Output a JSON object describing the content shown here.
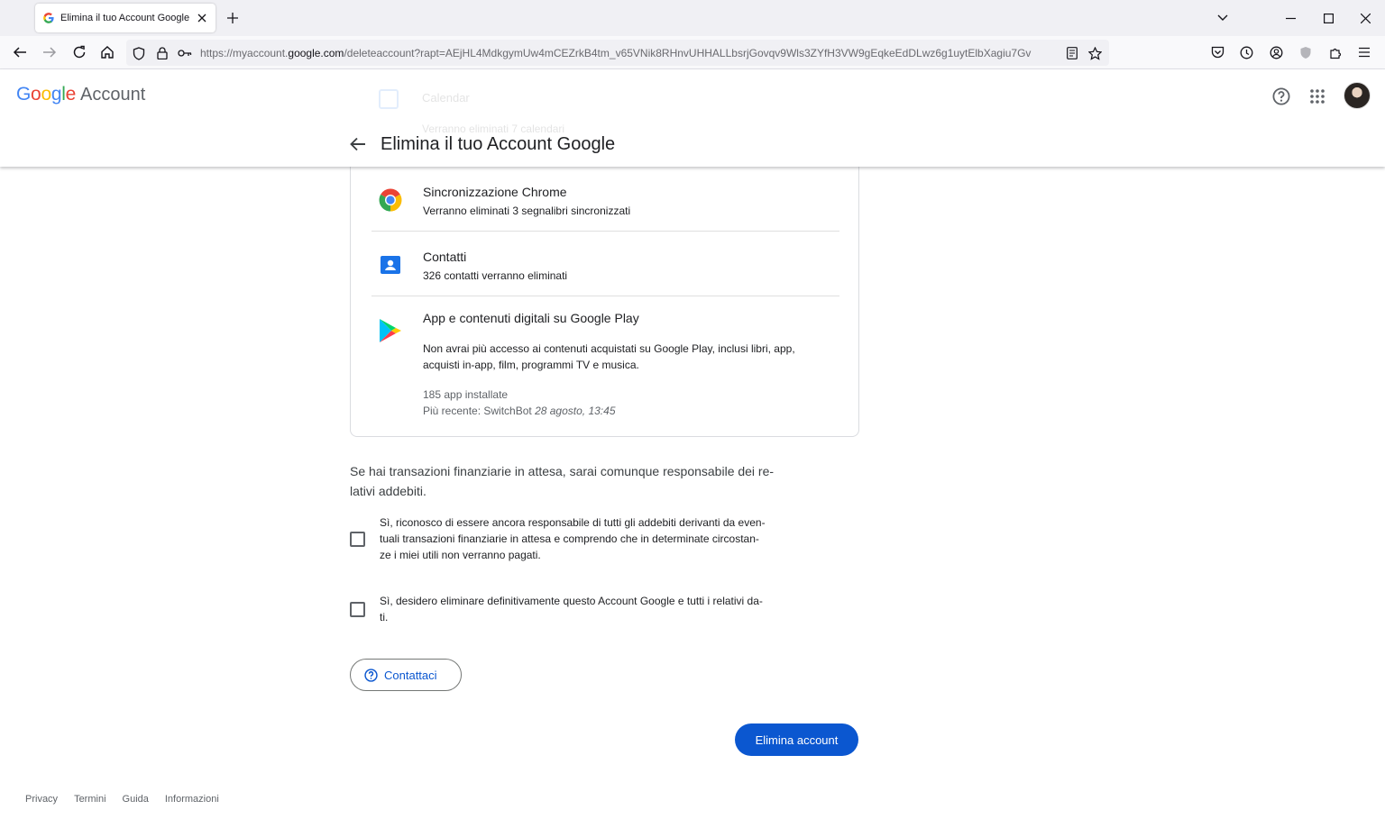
{
  "browser": {
    "tab_title": "Elimina il tuo Account Google",
    "url_prefix": "https://myaccount.",
    "url_domain": "google.com",
    "url_path": "/deleteaccount?rapt=AEjHL4MdkgymUw4mCEZrkB4tm_v65VNik8RHnvUHHALLbsrjGovqv9Wls3ZYfH3VW9gEqkeEdDLwz6g1uytElbXagiu7Gv"
  },
  "header": {
    "logo_letters": [
      "G",
      "o",
      "o",
      "g",
      "l",
      "e"
    ],
    "logo_colors": [
      "#4285f4",
      "#ea4335",
      "#fbbc05",
      "#4285f4",
      "#34a853",
      "#ea4335"
    ],
    "logo_suffix": "Account",
    "page_title": "Elimina il tuo Account Google",
    "faded_item_title": "Calendar",
    "faded_item_subtitle": "Verranno eliminati 7 calendari"
  },
  "services": [
    {
      "icon": "chrome-icon",
      "title": "Sincronizzazione Chrome",
      "subtitle": "Verranno eliminati 3 segnalibri sincronizzati"
    },
    {
      "icon": "contacts-icon",
      "title": "Contatti",
      "subtitle": "326 contatti verranno eliminati"
    },
    {
      "icon": "google-play-icon",
      "title": "App e contenuti digitali su Google Play",
      "description_line1": "Non avrai più accesso ai contenuti acquistati su Google Play, inclusi libri, app,",
      "description_line2": "acquisti in-app, film, programmi TV e musica.",
      "installed": "185 app installate",
      "recent_prefix": "Più recente: SwitchBot",
      "recent_date": "28 agosto, 13:45"
    }
  ],
  "notice": {
    "line1": "Se hai transazioni finanziarie in attesa, sarai comunque responsabile dei re-",
    "line2": "lativi addebiti."
  },
  "checkboxes": [
    {
      "checked": false,
      "line1": "Sì, riconosco di essere ancora responsabile di tutti gli addebiti derivanti da even-",
      "line2": "tuali transazioni finanziarie in attesa e comprendo che in determinate circostan-",
      "line3": "ze i miei utili non verranno pagati."
    },
    {
      "checked": false,
      "line1": "Sì, desidero eliminare definitivamente questo Account Google e tutti i relativi da-",
      "line2": "ti."
    }
  ],
  "buttons": {
    "contact": "Contattaci",
    "delete": "Elimina account"
  },
  "footer": [
    "Privacy",
    "Termini",
    "Guida",
    "Informazioni"
  ],
  "colors": {
    "primary_blue": "#0b57d0",
    "text": "#202124"
  }
}
